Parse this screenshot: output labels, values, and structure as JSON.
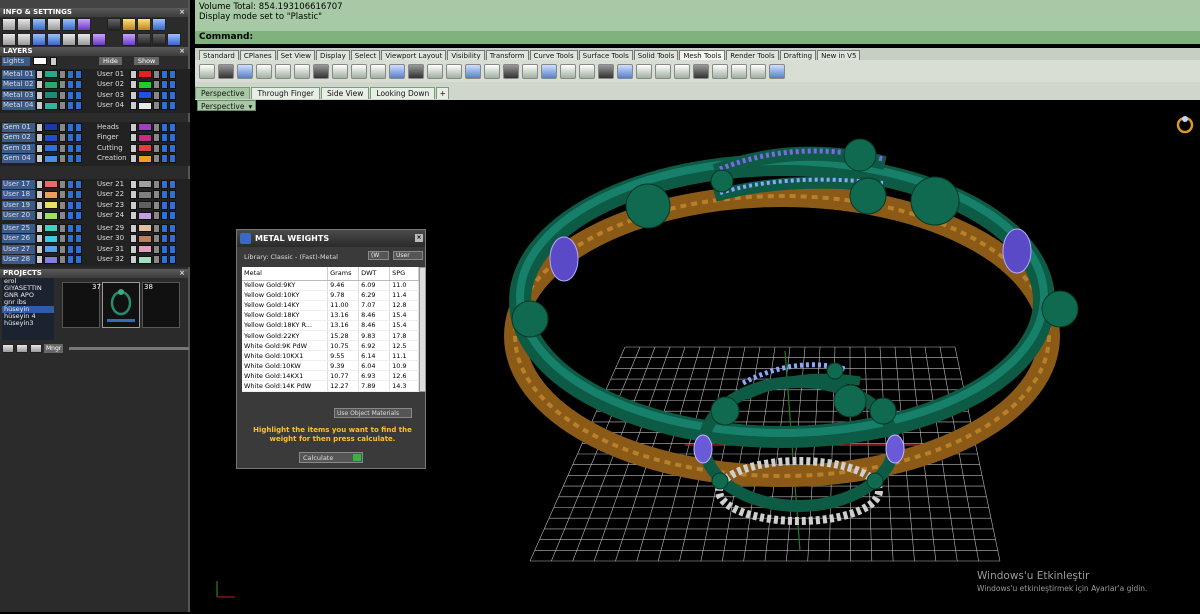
{
  "left_panel": {
    "info_title": "INFO & SETTINGS",
    "layers_title": "LAYERS",
    "projects_title": "PROJECTS",
    "lights_label": "Lights",
    "hide_label": "Hide",
    "show_label": "Show",
    "layers_left": [
      {
        "name": "Metal 01",
        "color": "#2aa88a"
      },
      {
        "name": "Metal 02",
        "color": "#2aa86a"
      },
      {
        "name": "Metal 03",
        "color": "#1e8a78"
      },
      {
        "name": "Metal 04",
        "color": "#3cb0a0"
      },
      {
        "name": "Gem 01",
        "color": "#1a3aa8"
      },
      {
        "name": "Gem 02",
        "color": "#2050c8"
      },
      {
        "name": "Gem 03",
        "color": "#3070d8"
      },
      {
        "name": "Gem 04",
        "color": "#4a90e8"
      },
      {
        "name": "User 17",
        "color": "#e86a6a"
      },
      {
        "name": "User 18",
        "color": "#e8a060"
      },
      {
        "name": "User 19",
        "color": "#e8e060"
      },
      {
        "name": "User 20",
        "color": "#a0e060"
      },
      {
        "name": "User 25",
        "color": "#40d0c0"
      },
      {
        "name": "User 26",
        "color": "#40c8e8"
      },
      {
        "name": "User 27",
        "color": "#60a0e8"
      },
      {
        "name": "User 28",
        "color": "#8080e0"
      }
    ],
    "layers_right": [
      {
        "name": "User 01",
        "color": "#e82020"
      },
      {
        "name": "User 02",
        "color": "#20d020"
      },
      {
        "name": "User 03",
        "color": "#2050e8"
      },
      {
        "name": "User 04",
        "color": "#e8e8e8"
      },
      {
        "name": "Heads",
        "color": "#a040c0"
      },
      {
        "name": "Finger",
        "color": "#c03080"
      },
      {
        "name": "Cutting",
        "color": "#e04040"
      },
      {
        "name": "Creation",
        "color": "#f0a020"
      },
      {
        "name": "User 21",
        "color": "#a0a0a0"
      },
      {
        "name": "User 22",
        "color": "#808080"
      },
      {
        "name": "User 23",
        "color": "#606060"
      },
      {
        "name": "User 24",
        "color": "#c0a0e0"
      },
      {
        "name": "User 29",
        "color": "#e0c0a0"
      },
      {
        "name": "User 30",
        "color": "#c08060"
      },
      {
        "name": "User 31",
        "color": "#e0a0c0"
      },
      {
        "name": "User 32",
        "color": "#a0e0c0"
      }
    ],
    "projects": [
      "erol",
      "GIYASETTIN",
      "GNR APO",
      "gnr ibs",
      "hüseyin",
      "hüseyin 4",
      "hüseyin3"
    ],
    "selected_project_index": 4,
    "thumb_numbers": [
      "37",
      "38"
    ],
    "mngr_label": "Mngr"
  },
  "history": {
    "line1": "Volume Total: 854.193106616707",
    "line2": "Display mode set to \"Plastic\"",
    "command_label": "Command:"
  },
  "tabs": [
    "Standard",
    "CPlanes",
    "Set View",
    "Display",
    "Select",
    "Viewport Layout",
    "Visibility",
    "Transform",
    "Curve Tools",
    "Surface Tools",
    "Solid Tools",
    "Mesh Tools",
    "Render Tools",
    "Drafting",
    "New in V5"
  ],
  "active_tab": "Mesh Tools",
  "viewport_tabs": [
    "Perspective",
    "Through Finger",
    "Side View",
    "Looking Down"
  ],
  "viewport_label": "Perspective",
  "metal_weights": {
    "title": "METAL WEIGHTS",
    "library": "Library: Classic - (Fast)-Metal",
    "unit1": "(W",
    "unit2": "User",
    "columns": [
      "Metal",
      "Grams",
      "DWT",
      "SPG"
    ],
    "rows": [
      [
        "Yellow Gold:9KY",
        "9.46",
        "6.09",
        "11.0"
      ],
      [
        "Yellow Gold:10KY",
        "9.78",
        "6.29",
        "11.4"
      ],
      [
        "Yellow Gold:14KY",
        "11.00",
        "7.07",
        "12.8"
      ],
      [
        "Yellow Gold:18KY",
        "13.16",
        "8.46",
        "15.4"
      ],
      [
        "Yellow Gold:18KY R...",
        "13.16",
        "8.46",
        "15.4"
      ],
      [
        "Yellow Gold:22KY",
        "15.28",
        "9.83",
        "17.8"
      ],
      [
        "White Gold:9K PdW",
        "10.75",
        "6.92",
        "12.5"
      ],
      [
        "White Gold:10KX1",
        "9.55",
        "6.14",
        "11.1"
      ],
      [
        "White Gold:10KW",
        "9.39",
        "6.04",
        "10.9"
      ],
      [
        "White Gold:14KX1",
        "10.77",
        "6.93",
        "12.6"
      ],
      [
        "White Gold:14K PdW",
        "12.27",
        "7.89",
        "14.3"
      ]
    ],
    "use_object": "Use Object Materials",
    "hint": "Highlight the items you want to find the weight for then press calculate.",
    "calculate": "Calculate"
  },
  "watermark": {
    "line1": "Windows'u Etkinleştir",
    "line2": "Windows'u etkinleştirmek için Ayarlar'a gidin."
  }
}
